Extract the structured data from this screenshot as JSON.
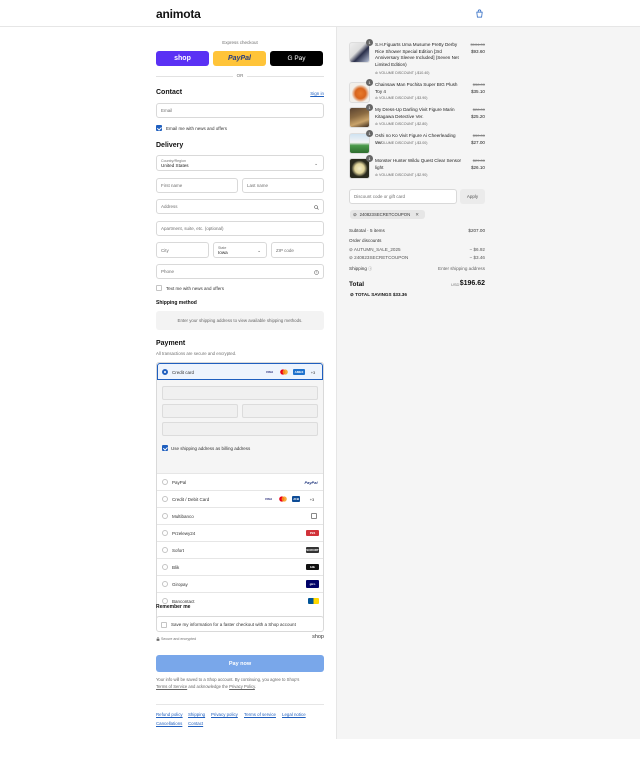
{
  "header": {
    "logo": "animota",
    "cart_icon": "shopping-bag-icon"
  },
  "express": {
    "label": "Express checkout",
    "shop": "shop",
    "paypal": "PayPal",
    "gpay": "G Pay",
    "or": "OR"
  },
  "contact": {
    "title": "Contact",
    "sign_in": "Sign in",
    "email_placeholder": "Email",
    "news_label": "Email me with news and offers",
    "news_checked": true
  },
  "delivery": {
    "title": "Delivery",
    "country_label": "Country/Region",
    "country_value": "United States",
    "first_name": "First name",
    "last_name": "Last name",
    "address": "Address",
    "apartment": "Apartment, suite, etc. (optional)",
    "city": "City",
    "state_label": "State",
    "state_value": "Iowa",
    "zip": "ZIP code",
    "phone": "Phone",
    "text_label": "Text me with news and offers"
  },
  "shipping": {
    "title": "Shipping method",
    "notice": "Enter your shipping address to view available shipping methods."
  },
  "payment": {
    "title": "Payment",
    "subtitle": "All transactions are secure and encrypted.",
    "credit_card": "Credit card",
    "more_cards": "+3",
    "billing_label": "Use shipping address as billing address",
    "methods": [
      "PayPal",
      "Credit / Debit Card",
      "Multibanco",
      "Przelewy24",
      "Sofort",
      "Blik",
      "Giropay",
      "Bancontact"
    ],
    "colors": {
      "accent": "#1f5fbf",
      "shop": "#5a31f4",
      "paypal": "#ffc439"
    }
  },
  "remember": {
    "title": "Remember me",
    "label": "Save my information for a faster checkout with a Shop account",
    "secure": "Secure and encrypted",
    "shop": "shop"
  },
  "pay_now": "Pay now",
  "legal": {
    "text1": "Your info will be saved to a Shop account. By continuing, you agree to Shop's",
    "terms": "Terms of Service",
    "text2": "and acknowledge the",
    "privacy": "Privacy Policy",
    "end": "."
  },
  "footer": {
    "links": [
      "Refund policy",
      "Shipping",
      "Privacy policy",
      "Terms of service",
      "Legal notice",
      "Cancellations",
      "Contact"
    ]
  },
  "cart": {
    "items": [
      {
        "name": "S.H.Figuarts Uma Musume Pretty Derby Rice Shower Special Edition [3rd Anniversary Sleeve Included] (Seven Net Limited Edition)",
        "qty": "1",
        "orig": "$104.00",
        "price": "$93.60",
        "discount": "VOLUME DISCOUNT (-$10.40)"
      },
      {
        "name": "Chainsaw Man Pochita Super BIG Plush Toy 4",
        "qty": "1",
        "orig": "$38.00",
        "price": "$35.10",
        "discount": "VOLUME DISCOUNT (-$3.90)"
      },
      {
        "name": "My Dress-Up Darling Vivit Figure Marin Kitagawa Detective Ver.",
        "qty": "1",
        "orig": "$28.00",
        "price": "$25.20",
        "discount": "VOLUME DISCOUNT (-$2.80)"
      },
      {
        "name": "Oshi no Ko Vivit Figure Ai Cheerleading Ver.",
        "qty": "1",
        "orig": "$30.00",
        "price": "$27.00",
        "discount": "VOLUME DISCOUNT (-$3.00)"
      },
      {
        "name": "Monster Hunter Wildu Quest Clear Sensor light",
        "qty": "1",
        "orig": "$29.00",
        "price": "$26.10",
        "discount": "VOLUME DISCOUNT (-$2.90)"
      }
    ],
    "discount_placeholder": "Discount code or gift card",
    "apply": "Apply",
    "applied_code": "240823SECRETCOUPON"
  },
  "summary": {
    "subtotal_label": "Subtotal · 5 items",
    "subtotal_value": "$207.00",
    "order_discounts": "Order discounts",
    "d1_label": "AUTUMN_SALE_2025",
    "d1_value": "− $6.92",
    "d2_label": "240823SECRETCOUPON",
    "d2_value": "− $3.46",
    "shipping_label": "Shipping",
    "shipping_value": "Enter shipping address",
    "total_label": "Total",
    "currency": "USD",
    "total_value": "$196.62",
    "savings_label": "TOTAL SAVINGS",
    "savings_value": "$33.36"
  }
}
